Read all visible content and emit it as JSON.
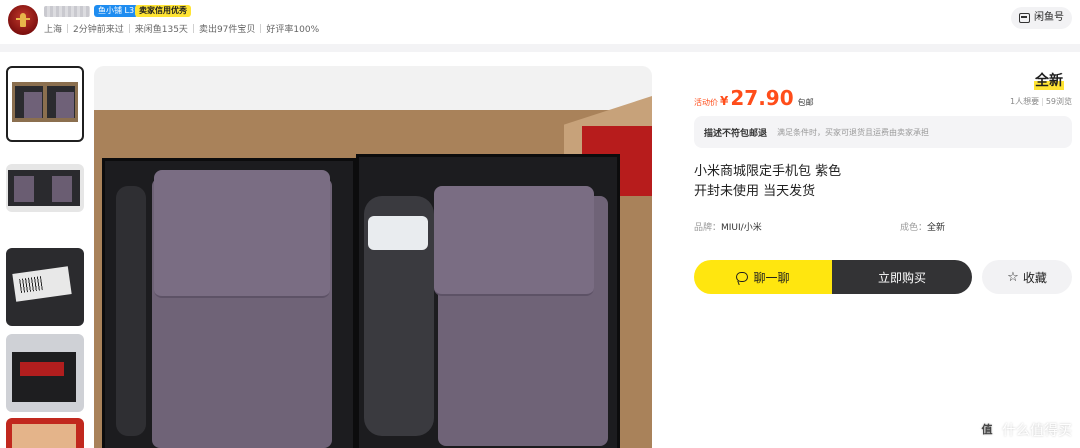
{
  "seller": {
    "level_badge": "鱼小铺 L3",
    "credit_badge": "卖家信用优秀",
    "meta": [
      "上海",
      "2分钟前来过",
      "来闲鱼135天",
      "卖出97件宝贝",
      "好评率100%"
    ]
  },
  "header": {
    "xianyu_button": "闲鱼号"
  },
  "product": {
    "condition_tag": "全新",
    "price_label": "活动价",
    "currency": "¥",
    "price": "27.90",
    "shipping": "包邮",
    "stats": {
      "wants": "1人想要",
      "views": "59浏览"
    },
    "notice_title": "描述不符包邮退",
    "notice_text": "满足条件时，买家可退货且运费由卖家承担",
    "title_line1": "小米商城限定手机包 紫色",
    "title_line2": "开封未使用 当天发货",
    "brand_label": "品牌：",
    "brand_value": "MIUI/小米",
    "condition_label": "成色：",
    "condition_value": "全新"
  },
  "actions": {
    "chat": "聊一聊",
    "buy": "立即购买",
    "favorite": "收藏"
  },
  "icons": {
    "chat": "chat-bubble-icon",
    "favorite": "star-icon",
    "store": "store-icon"
  },
  "watermark": {
    "text": "什么值得买",
    "icon": "值"
  },
  "colors": {
    "price": "#ff4d1a",
    "chat_button": "#ffe60f",
    "buy_button": "#333335",
    "level_badge": "#1e8cf0"
  }
}
